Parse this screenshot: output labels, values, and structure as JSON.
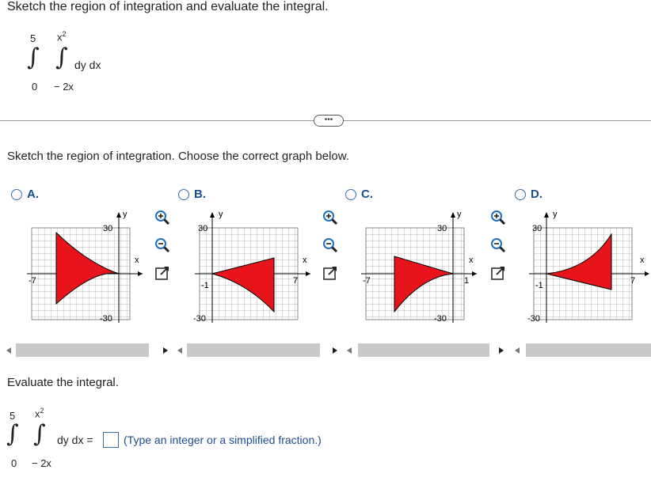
{
  "prompt": "Sketch the region of integration and evaluate the integral.",
  "integral": {
    "outer_upper": "5",
    "outer_lower": "0",
    "inner_upper_base": "x",
    "inner_upper_exp": "2",
    "inner_lower": "− 2x",
    "differentials": "dy dx"
  },
  "more_button": "•••",
  "part1_instruction": "Sketch the region of integration. Choose the correct graph below.",
  "options": [
    {
      "label": "A.",
      "xlabel": "x",
      "ylabel": "y",
      "xtick": "-7",
      "ytick_top": "30",
      "ytick_bottom": "-30"
    },
    {
      "label": "B.",
      "xlabel": "x",
      "ylabel": "y",
      "xtick_left": "-1",
      "xtick": "7",
      "ytick_top": "30",
      "ytick_bottom": "-30"
    },
    {
      "label": "C.",
      "xlabel": "x",
      "ylabel": "y",
      "xtick": "-7",
      "xtick_right": "1",
      "ytick_top": "30",
      "ytick_bottom": "-30"
    },
    {
      "label": "D.",
      "xlabel": "x",
      "ylabel": "y",
      "xtick_left": "-1",
      "xtick": "7",
      "ytick_top": "30",
      "ytick_bottom": "-30"
    }
  ],
  "tool_icons": [
    "zoom-in-icon",
    "zoom-out-icon",
    "expand-icon"
  ],
  "part2_instruction": "Evaluate the integral.",
  "answer": {
    "equals": "dy dx =",
    "value": "",
    "hint": "(Type an integer or a simplified fraction.)"
  },
  "colors": {
    "region_fill": "#e8141b",
    "link_blue": "#1c4d8c",
    "radio_border": "#3a6ea5"
  }
}
